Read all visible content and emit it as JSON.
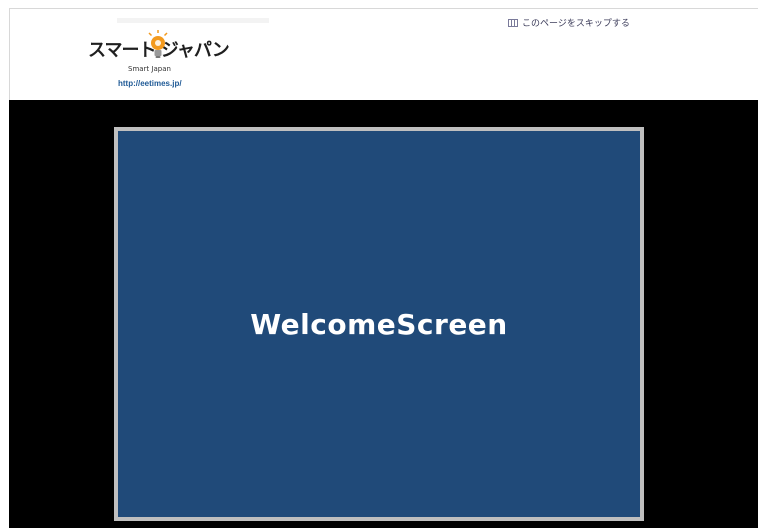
{
  "header": {
    "logo": {
      "title": "スマート ジャパン",
      "subtitle": "Smart Japan",
      "url": "http://eetimes.jp/"
    },
    "skip_link": {
      "icon": "skip-icon",
      "label": "このページをスキップする"
    }
  },
  "main": {
    "welcome_screen": {
      "label": "WelcomeScreen"
    }
  },
  "colors": {
    "welcome_bg": "#204a79",
    "welcome_border": "#bfbfbf",
    "stage_bg": "#000000",
    "url_text": "#1f5a96",
    "bulb": "#f39a1e"
  }
}
